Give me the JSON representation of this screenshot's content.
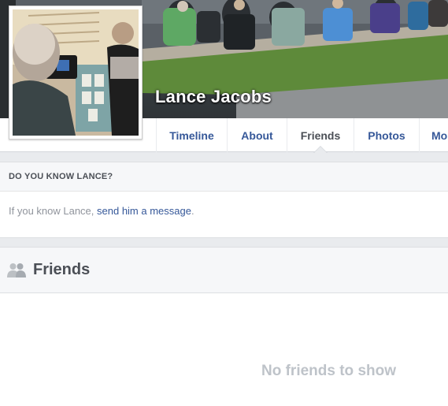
{
  "profile": {
    "name": "Lance Jacobs"
  },
  "nav": {
    "tabs": [
      {
        "label": "Timeline",
        "active": false
      },
      {
        "label": "About",
        "active": false
      },
      {
        "label": "Friends",
        "active": true
      },
      {
        "label": "Photos",
        "active": false
      },
      {
        "label": "Mo",
        "active": false
      }
    ]
  },
  "know_box": {
    "heading": "DO YOU KNOW LANCE?",
    "text_prefix": "If you know Lance, ",
    "link_text": "send him a message",
    "text_suffix": "."
  },
  "friends_section": {
    "icon": "friends-icon",
    "title": "Friends",
    "empty_message": "No friends to show"
  },
  "colors": {
    "link": "#365899",
    "muted": "#90949c",
    "empty": "#bec3c9",
    "background": "#e9ebee"
  }
}
